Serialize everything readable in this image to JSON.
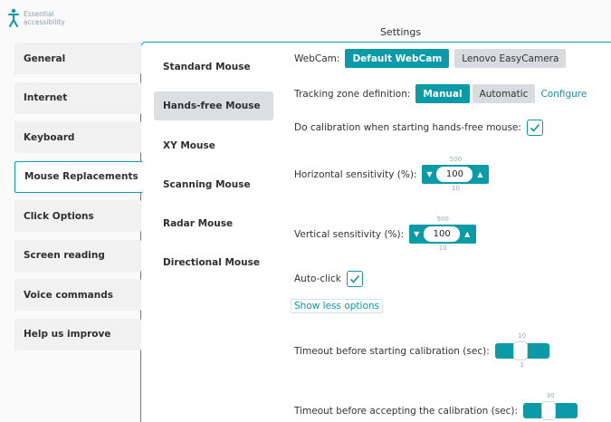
{
  "app": {
    "logo_text": "Essential accessibility"
  },
  "header": {
    "title": "Settings"
  },
  "categories": [
    {
      "label": "General"
    },
    {
      "label": "Internet"
    },
    {
      "label": "Keyboard"
    },
    {
      "label": "Mouse Replacements"
    },
    {
      "label": "Click Options"
    },
    {
      "label": "Screen reading"
    },
    {
      "label": "Voice commands"
    },
    {
      "label": "Help us improve"
    }
  ],
  "mouse_types": [
    {
      "label": "Standard Mouse"
    },
    {
      "label": "Hands-free Mouse"
    },
    {
      "label": "XY Mouse"
    },
    {
      "label": "Scanning Mouse"
    },
    {
      "label": "Radar Mouse"
    },
    {
      "label": "Directional Mouse"
    }
  ],
  "settings": {
    "webcam": {
      "label": "WebCam:",
      "option1": "Default WebCam",
      "option2": "Lenovo EasyCamera"
    },
    "tracking": {
      "label": "Tracking zone definition:",
      "option1": "Manual",
      "option2": "Automatic",
      "configure": "Configure"
    },
    "calibration_start": {
      "label": "Do calibration when starting hands-free mouse:"
    },
    "horizontal": {
      "label": "Horizontal sensitivity (%):",
      "value": "100",
      "max": "500",
      "min": "10"
    },
    "vertical": {
      "label": "Vertical sensitivity (%):",
      "value": "100",
      "max": "500",
      "min": "10"
    },
    "autoclick": {
      "label": "Auto-click"
    },
    "show_less": "Show less options",
    "timeout_start": {
      "label": "Timeout before starting calibration (sec):",
      "max": "10",
      "min": "1"
    },
    "timeout_accept": {
      "label": "Timeout before accepting the calibration (sec):",
      "max": "30"
    }
  },
  "colors": {
    "accent": "#0a9aa8"
  }
}
